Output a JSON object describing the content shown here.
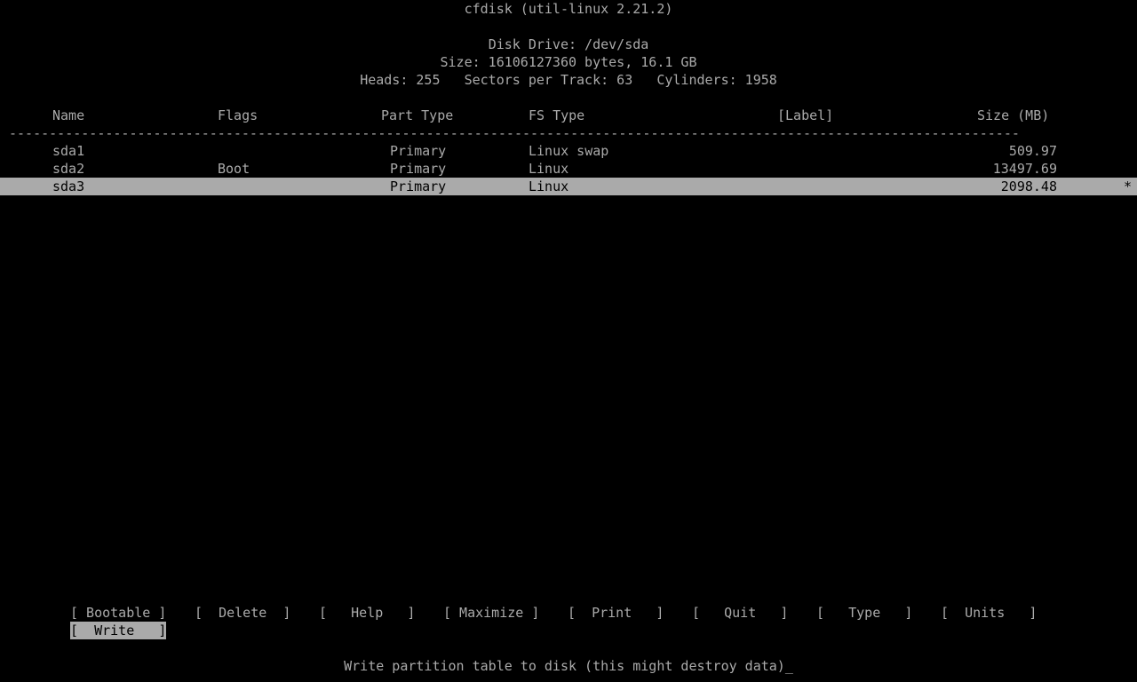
{
  "app": {
    "title": "cfdisk (util-linux 2.21.2)"
  },
  "disk": {
    "drive_line": "Disk Drive: /dev/sda",
    "size_line": "Size: 16106127360 bytes, 16.1 GB",
    "geometry_line": "Heads: 255   Sectors per Track: 63   Cylinders: 1958"
  },
  "table": {
    "headers": {
      "name": "Name",
      "flags": "Flags",
      "part_type": "Part Type",
      "fs_type": "FS Type",
      "label": "[Label]",
      "size": "Size (MB)"
    },
    "separator": "------------------------------------------------------------------------------------------------------------------------------",
    "rows": [
      {
        "name": "sda1",
        "flags": "",
        "part_type": "Primary",
        "fs_type": "Linux swap",
        "label": "",
        "size": "509.97",
        "marker": "",
        "selected": false
      },
      {
        "name": "sda2",
        "flags": "Boot",
        "part_type": "Primary",
        "fs_type": "Linux",
        "label": "",
        "size": "13497.69",
        "marker": "",
        "selected": false
      },
      {
        "name": "sda3",
        "flags": "",
        "part_type": "Primary",
        "fs_type": "Linux",
        "label": "",
        "size": "2098.48",
        "marker": "*",
        "selected": true
      }
    ]
  },
  "menu": {
    "row1": [
      {
        "label": "[ Bootable ]",
        "active": false
      },
      {
        "label": "[  Delete  ]",
        "active": false
      },
      {
        "label": "[   Help   ]",
        "active": false
      },
      {
        "label": "[ Maximize ]",
        "active": false
      },
      {
        "label": "[  Print   ]",
        "active": false
      },
      {
        "label": "[   Quit   ]",
        "active": false
      },
      {
        "label": "[   Type   ]",
        "active": false
      },
      {
        "label": "[  Units   ]",
        "active": false
      }
    ],
    "row2": [
      {
        "label": "[  Write   ]",
        "active": true
      }
    ]
  },
  "status": {
    "text": "Write partition table to disk (this might destroy data)",
    "cursor": "_"
  }
}
